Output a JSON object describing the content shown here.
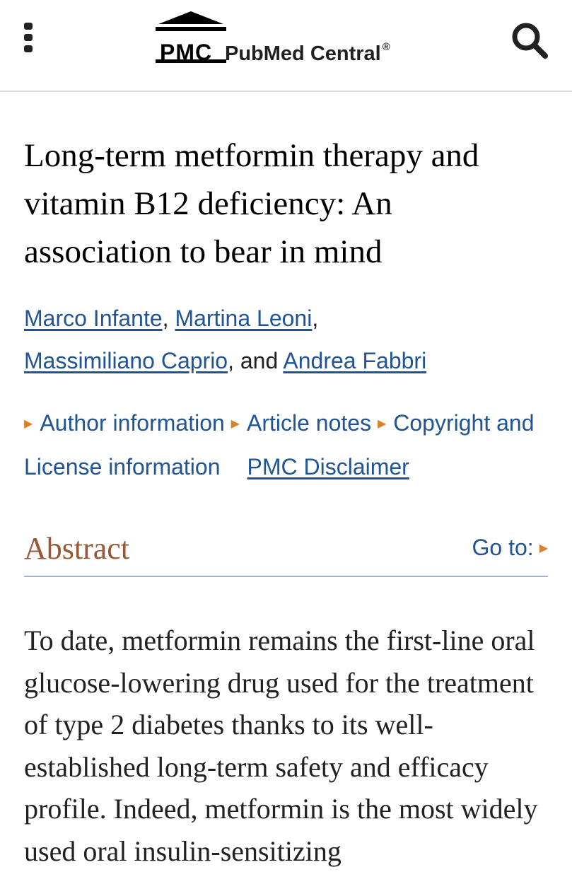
{
  "header": {
    "logo_short": "PMC",
    "logo_name": "PubMed Central",
    "logo_mark": "®",
    "menu_icon": "kebab-menu-icon",
    "search_icon": "search-icon"
  },
  "article": {
    "title": "Long-term metformin therapy and vitamin B12 deficiency: An association to bear in mind",
    "authors": [
      {
        "name": "Marco Infante",
        "sep": ", "
      },
      {
        "name": "Martina Leoni",
        "sep": ","
      },
      {
        "name": "Massimiliano Caprio",
        "sep": ", and "
      },
      {
        "name": "Andrea Fabbri",
        "sep": ""
      }
    ],
    "info_links": {
      "author_information": "Author information",
      "article_notes": "Article notes",
      "copyright": "Copyright and License information",
      "disclaimer": "PMC Disclaimer"
    }
  },
  "abstract": {
    "heading": "Abstract",
    "goto_label": "Go to:",
    "text": "To date, metformin remains the first-line oral glucose-lowering drug used for the treatment of type 2 diabetes thanks to its well-established long-term safety and efficacy profile. Indeed, metformin is the most widely used oral insulin-sensitizing"
  },
  "colors": {
    "link": "#205493",
    "accent_triangle": "#d9822b",
    "abstract_heading": "#985735",
    "divider": "#9fb4cf"
  }
}
